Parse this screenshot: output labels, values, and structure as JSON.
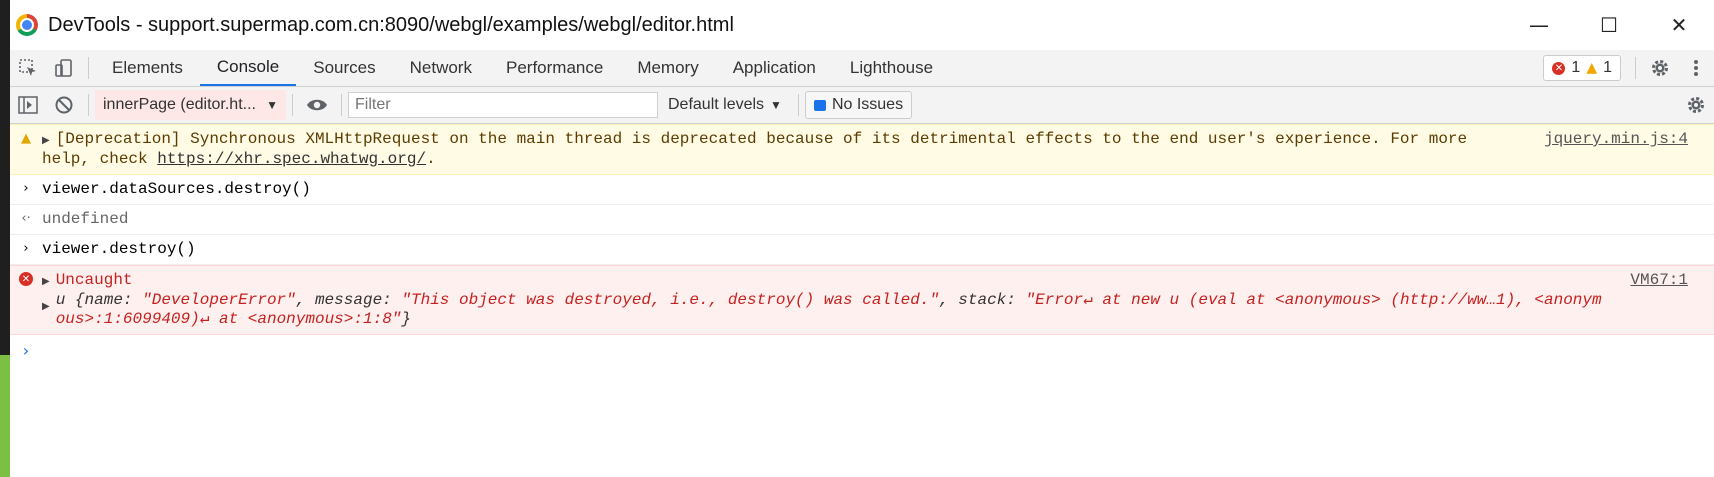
{
  "window": {
    "title": "DevTools - support.supermap.com.cn:8090/webgl/examples/webgl/editor.html",
    "minimize": "—",
    "maximize": "☐",
    "close": "✕"
  },
  "tabs": [
    "Elements",
    "Console",
    "Sources",
    "Network",
    "Performance",
    "Memory",
    "Application",
    "Lighthouse"
  ],
  "active_tab": "Console",
  "counts": {
    "errors": "1",
    "warnings": "1"
  },
  "toolbar": {
    "context": "innerPage (editor.ht...",
    "filter_placeholder": "Filter",
    "levels": "Default levels",
    "issues": "No Issues"
  },
  "messages": {
    "warn": {
      "text": "[Deprecation] Synchronous XMLHttpRequest on the main thread is deprecated because of its detrimental effects to the end user's experience. For more",
      "line2_prefix": "help, check ",
      "link": "https://xhr.spec.whatwg.org/",
      "line2_suffix": ".",
      "source": "jquery.min.js:4"
    },
    "input1": "viewer.dataSources.destroy()",
    "output1": "undefined",
    "input2": "viewer.destroy()",
    "error": {
      "title": "Uncaught",
      "source": "VM67:1",
      "obj_prefix": "u {name: ",
      "name_val": "\"DeveloperError\"",
      "msg_key": ", message: ",
      "msg_val": "\"This object was destroyed, i.e., destroy() was called.\"",
      "stack_key": ", stack: ",
      "stack_val1": "\"Error↵    at new u (eval at <anonymous> (http://ww…1), <anonym",
      "stack_val2": "ous>:1:6099409)↵    at <anonymous>:1:8\"",
      "closing": "}"
    }
  }
}
